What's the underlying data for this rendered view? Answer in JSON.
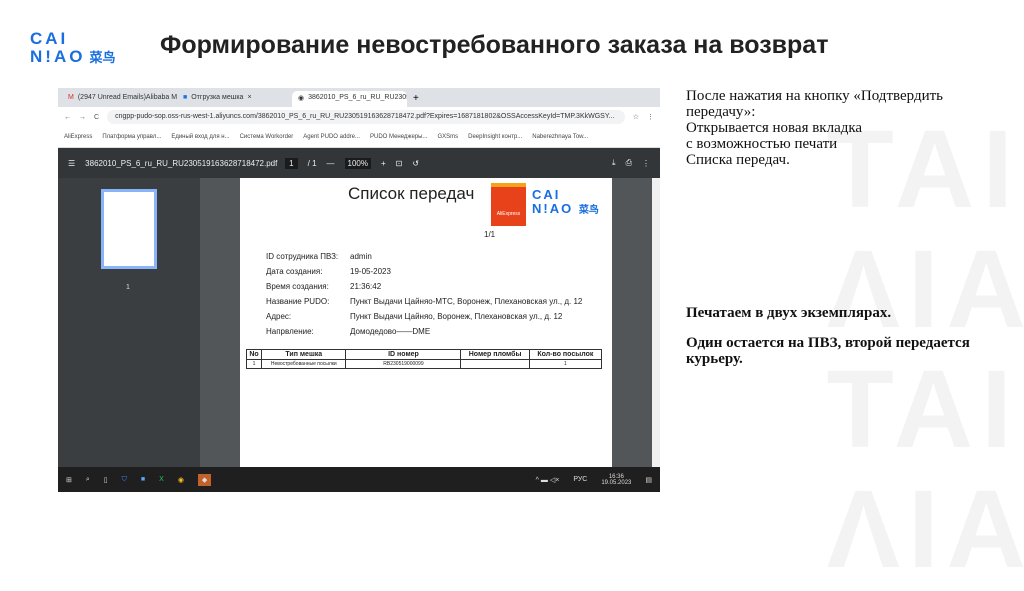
{
  "logo": {
    "line1": "CAI",
    "line2": "N!AO",
    "cn": "菜鸟"
  },
  "slide_title": "Формирование невостребованного заказа на возврат",
  "browser": {
    "tabs": [
      "(2947 Unread Emails)Alibaba Ma",
      "Отгрузка мешка",
      "3862010_PS_6_ru_RU_RU230519"
    ],
    "url": "cngpp-pudo-sop.oss-rus-west-1.aliyuncs.com/3862010_PS_6_ru_RU_RU230519163628718472.pdf?Expires=1687181802&OSSAccessKeyId=TMP.3KkWGSY...",
    "bookmarks": [
      "AliExpress",
      "Платформа управл...",
      "Единый вход для н...",
      "Система Workorder",
      "Agent PUDO addre...",
      "PUDO Менеджеры...",
      "GXSms",
      "DeepInsight контр...",
      "Naberezhnaya Tow..."
    ]
  },
  "pdf": {
    "filename": "3862010_PS_6_ru_RU_RU230519163628718472.pdf",
    "page": "1",
    "pages": "/ 1",
    "zoom": "100%",
    "thumb_label": "1",
    "doc_title": "Список передач",
    "brand": "AliExpress",
    "page_count": "1/1",
    "fields": [
      {
        "k": "ID сотрудника ПВЗ:",
        "v": "admin"
      },
      {
        "k": "Дата создания:",
        "v": "19-05-2023"
      },
      {
        "k": "Время создания:",
        "v": "21:36:42"
      },
      {
        "k": "Название PUDO:",
        "v": "Пункт Выдачи Цайняо-МТС, Воронеж, Плехановская ул., д. 12"
      },
      {
        "k": "Адрес:",
        "v": "Пункт Выдачи Цайняо, Воронеж, Плехановская ул., д. 12"
      },
      {
        "k": "Напрвление:",
        "v": "Домодедово——DME"
      }
    ],
    "table": {
      "headers": [
        "No",
        "Тип мешка",
        "ID номер",
        "Номер пломбы",
        "Кол-во посылок"
      ],
      "rows": [
        [
          "1",
          "Невостребованные посылки",
          "RB230519000099",
          "",
          "1"
        ]
      ]
    }
  },
  "taskbar": {
    "lang": "РУС",
    "time": "16:36",
    "date": "19.05.2023"
  },
  "notes": {
    "p1": "После нажатия на кнопку «Подтвердить передачу»:",
    "p2": "Открывается новая вкладка с возможностью печати Списка передач.",
    "p3": "Печатаем в двух экземплярах.",
    "p4": "Один остается на ПВЗ, второй передается курьеру."
  }
}
